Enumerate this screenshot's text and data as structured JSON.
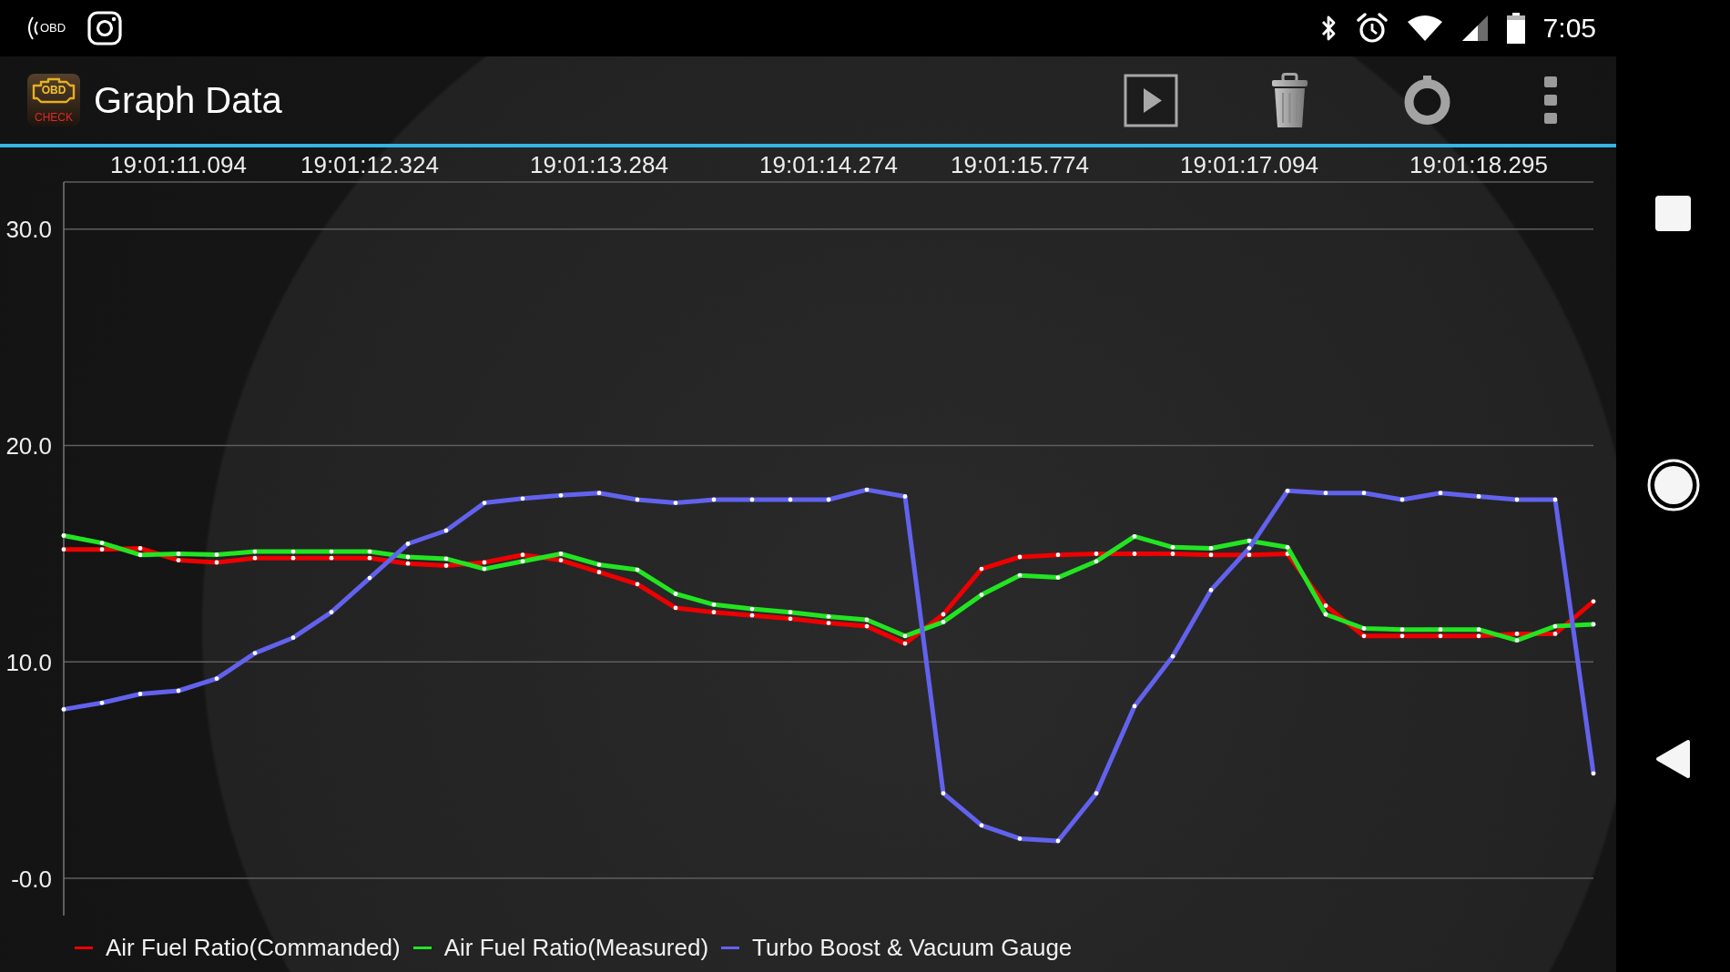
{
  "status_bar": {
    "notification_text": "OBD",
    "time": "7:05"
  },
  "app_bar": {
    "logo_text": "OBD",
    "logo_caption": "CHECK",
    "title": "Graph Data"
  },
  "graph": {
    "chart_data": {
      "type": "line",
      "grid": true,
      "categories": [
        null,
        null,
        null,
        "19:01:11.094",
        null,
        null,
        null,
        null,
        "19:01:12.324",
        null,
        null,
        null,
        null,
        null,
        "19:01:13.284",
        null,
        null,
        null,
        null,
        null,
        "19:01:14.274",
        null,
        null,
        null,
        null,
        "19:01:15.774",
        null,
        null,
        null,
        null,
        null,
        "19:01:17.094",
        null,
        null,
        null,
        null,
        null,
        "19:01:18.295",
        null,
        null,
        null
      ],
      "ylim": [
        -1.72,
        32.18
      ],
      "yticks": [
        {
          "value": 0,
          "label": "-0.0"
        },
        {
          "value": 10,
          "label": "10.0"
        },
        {
          "value": 20,
          "label": "20.0"
        },
        {
          "value": 30,
          "label": "30.0"
        }
      ],
      "series": [
        {
          "name": "Air Fuel Ratio(Commanded)",
          "color": "#ee0000",
          "values": [
            15.2,
            15.2,
            15.25,
            14.7,
            14.6,
            14.8,
            14.8,
            14.8,
            14.8,
            14.55,
            14.45,
            14.6,
            14.95,
            14.7,
            14.15,
            13.6,
            12.5,
            12.3,
            12.15,
            12.0,
            11.8,
            11.65,
            10.85,
            12.2,
            14.3,
            14.85,
            14.95,
            15.0,
            15.0,
            15.0,
            14.95,
            14.95,
            15.0,
            12.6,
            11.2,
            11.2,
            11.2,
            11.2,
            11.3,
            11.3,
            12.8
          ]
        },
        {
          "name": "Air Fuel Ratio(Measured)",
          "color": "#22e522",
          "values": [
            15.84,
            15.5,
            14.95,
            15.0,
            14.96,
            15.1,
            15.1,
            15.1,
            15.1,
            14.85,
            14.77,
            14.3,
            14.65,
            15.0,
            14.5,
            14.26,
            13.15,
            12.65,
            12.45,
            12.3,
            12.1,
            11.95,
            11.2,
            11.85,
            13.1,
            14.0,
            13.9,
            14.65,
            15.8,
            15.3,
            15.25,
            15.6,
            15.3,
            12.2,
            11.55,
            11.5,
            11.5,
            11.5,
            11.0,
            11.65,
            11.74
          ]
        },
        {
          "name": "Turbo Boost & Vacuum Gauge",
          "color": "#6262ee",
          "values": [
            7.81,
            8.11,
            8.52,
            8.67,
            9.23,
            10.41,
            11.12,
            12.3,
            13.88,
            15.46,
            16.07,
            17.35,
            17.55,
            17.7,
            17.81,
            17.5,
            17.35,
            17.5,
            17.5,
            17.5,
            17.5,
            17.96,
            17.65,
            3.93,
            2.45,
            1.84,
            1.73,
            3.93,
            7.96,
            10.26,
            13.32,
            15.26,
            17.91,
            17.81,
            17.81,
            17.5,
            17.81,
            17.65,
            17.5,
            17.5,
            4.85
          ]
        }
      ]
    }
  }
}
